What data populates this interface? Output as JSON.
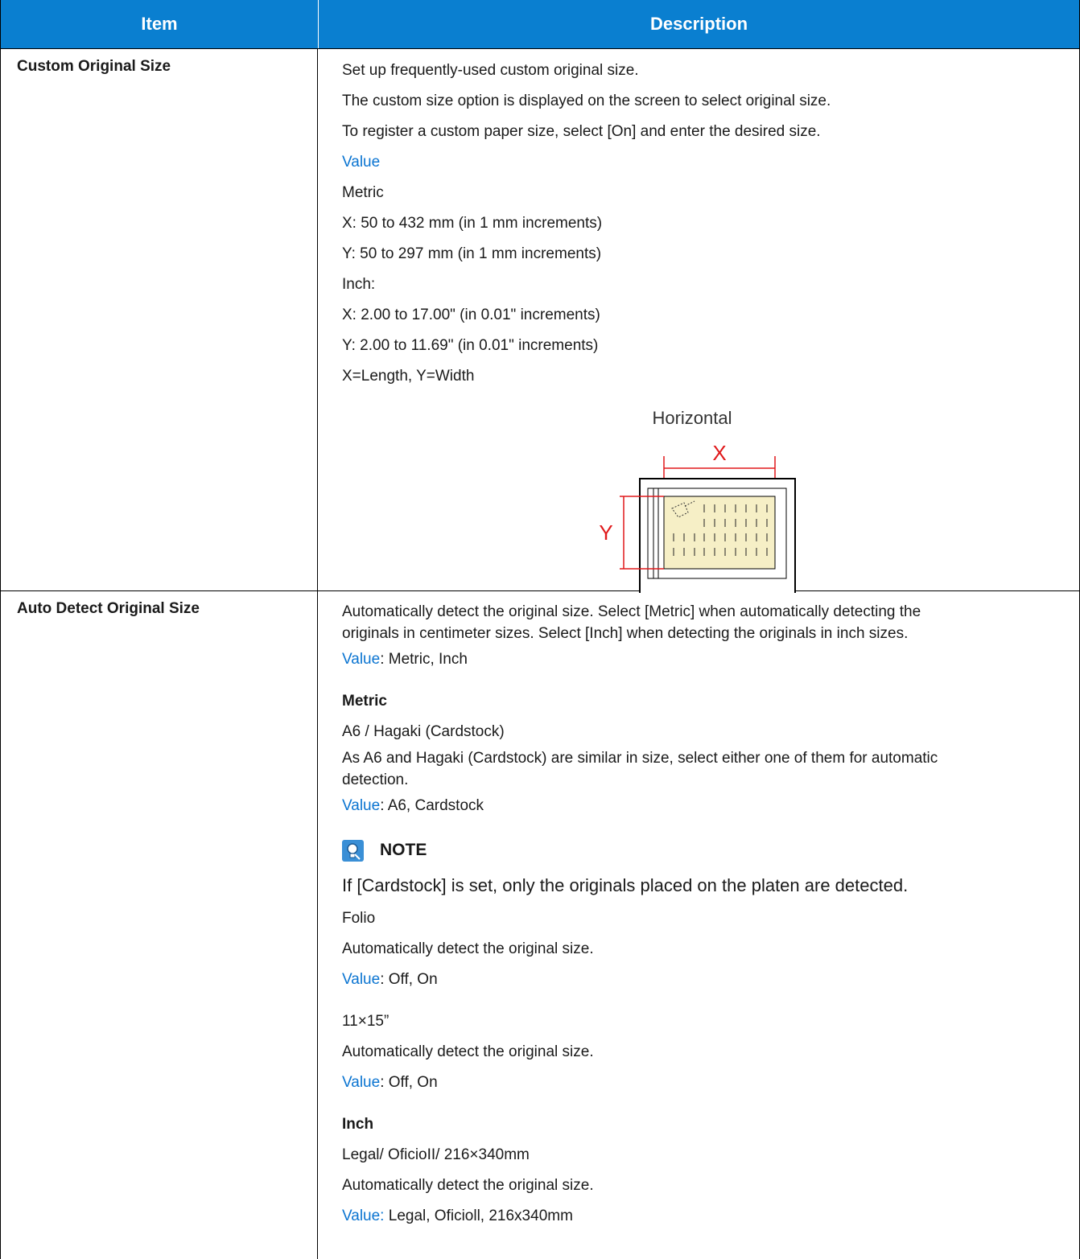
{
  "header": {
    "item": "Item",
    "description": "Description"
  },
  "row1": {
    "item": "Custom Original Size",
    "lines": [
      "Set up frequently-used custom original size.",
      "The custom size option is displayed on the screen to select original size.",
      "To register a custom paper size, select [On] and enter the desired size."
    ],
    "value_label": "Value",
    "metric_title": "Metric",
    "metric_x": "X: 50 to 432 mm (in 1 mm increments)",
    "metric_y": "Y: 50 to 297 mm (in 1 mm increments)",
    "inch_title": "Inch:",
    "inch_x": "X: 2.00 to 17.00\" (in 0.01\" increments)",
    "inch_y": "Y: 2.00 to 11.69\" (in 0.01\" increments)",
    "xy_note": "X=Length, Y=Width",
    "diagram": {
      "title": "Horizontal",
      "x_label": "X",
      "y_label": "Y"
    }
  },
  "row2": {
    "item": "Auto Detect Original Size",
    "intro_1": "Automatically detect the original size. Select [Metric] when automatically detecting the",
    "intro_2": "originals in centimeter sizes. Select [Inch] when detecting the originals in inch sizes.",
    "value_label": "Value",
    "value_1": ": Metric, Inch",
    "metric_title": "Metric",
    "a6_title": "A6 / Hagaki (Cardstock)",
    "a6_desc_1": "As A6 and Hagaki (Cardstock) are similar in size, select either one of them for automatic",
    "a6_desc_2": "detection.",
    "value_a6": ": A6, Cardstock",
    "note_title": "NOTE",
    "note_text": "If [Cardstock] is set, only the originals placed on the platen are detected.",
    "folio_title": "Folio",
    "folio_desc": "Automatically detect the original size.",
    "value_folio": ": Off, On",
    "size_title": "11×15”",
    "size_desc": "Automatically detect the original size.",
    "value_size": ": Off, On",
    "inch_title": "Inch",
    "legal_title": "Legal/ OficioII/ 216×340mm",
    "legal_desc": "Automatically detect the original size.",
    "value_legal_label": "Value:",
    "value_legal": " Legal, Oficioll, 216x340mm"
  },
  "colors": {
    "header_bg": "#0a7fd0",
    "link_blue": "#0a74d1",
    "dimension_red": "#e0191b",
    "paper_fill": "#f6efc6"
  }
}
